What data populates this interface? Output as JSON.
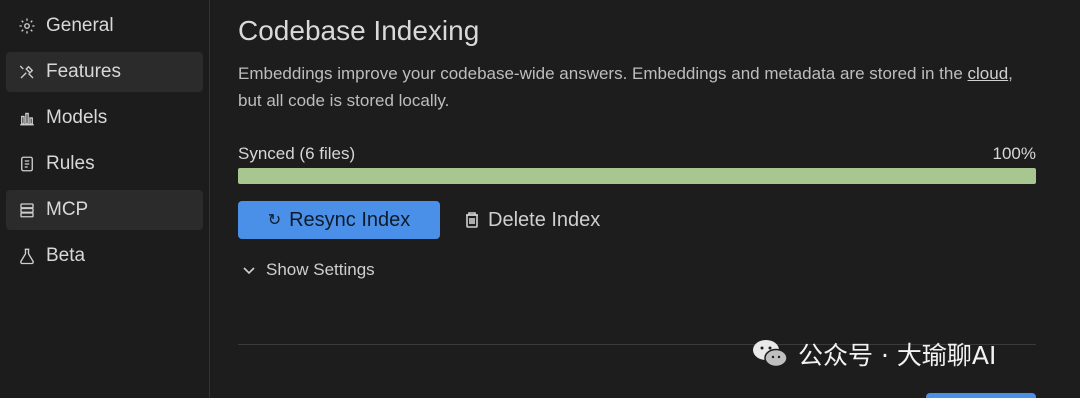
{
  "sidebar": {
    "items": [
      {
        "label": "General",
        "icon": "gear-icon"
      },
      {
        "label": "Features",
        "icon": "tools-icon"
      },
      {
        "label": "Models",
        "icon": "bar-chart-icon"
      },
      {
        "label": "Rules",
        "icon": "notebook-icon"
      },
      {
        "label": "MCP",
        "icon": "server-icon"
      },
      {
        "label": "Beta",
        "icon": "flask-icon"
      }
    ],
    "active": [
      "Features",
      "MCP"
    ]
  },
  "main": {
    "title": "Codebase Indexing",
    "description_before_link": "Embeddings improve your codebase-wide answers. Embeddings and metadata are stored in the ",
    "link_text": "cloud",
    "description_after_link": ", but all code is stored locally.",
    "sync_status": "Synced (6 files)",
    "sync_percent_label": "100%",
    "progress_fraction": 1.0,
    "resync_label": "Resync Index",
    "delete_label": "Delete Index",
    "settings_label": "Show Settings"
  },
  "watermark": {
    "text": "公众号 · 大瑜聊AI"
  },
  "colors": {
    "accent": "#4a90e8",
    "progress": "#a8c68f",
    "background": "#1d1d1d"
  }
}
